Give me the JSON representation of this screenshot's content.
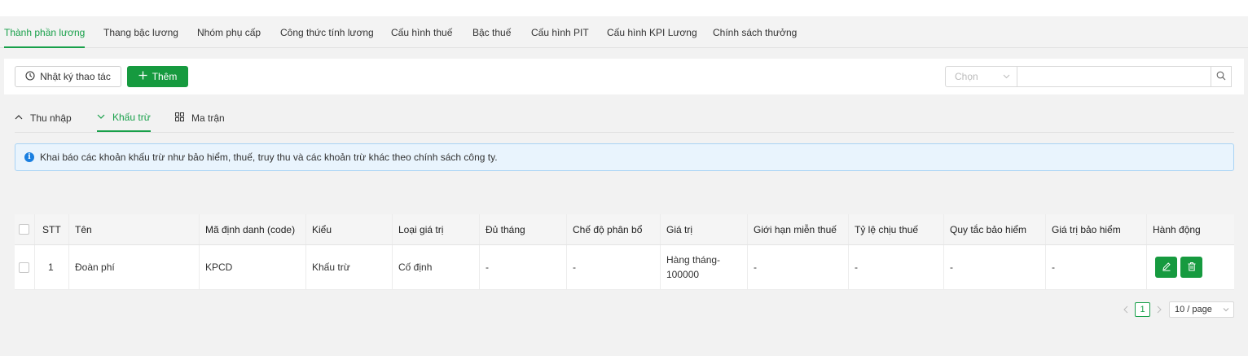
{
  "main_tabs": [
    {
      "label": "Thành phần lương"
    },
    {
      "label": "Thang bậc lương"
    },
    {
      "label": "Nhóm phụ cấp"
    },
    {
      "label": "Công thức tính lương"
    },
    {
      "label": "Cấu hình thuế"
    },
    {
      "label": "Bậc thuế"
    },
    {
      "label": "Cấu hình PIT"
    },
    {
      "label": "Cấu hình KPI Lương"
    },
    {
      "label": "Chính sách thưởng"
    }
  ],
  "toolbar": {
    "log_label": "Nhật ký thao tác",
    "add_label": "Thêm",
    "select_placeholder": "Chọn",
    "search_value": ""
  },
  "sub_tabs": [
    {
      "label": "Thu nhập",
      "icon": "chevron-up-icon"
    },
    {
      "label": "Khấu trừ",
      "icon": "chevron-down-icon"
    },
    {
      "label": "Ma trận",
      "icon": "grid-icon"
    }
  ],
  "alert": {
    "text": "Khai báo các khoản khấu trừ như bảo hiểm, thuế, truy thu và các khoản trừ khác theo chính sách công ty."
  },
  "table": {
    "columns": [
      "STT",
      "Tên",
      "Mã định danh (code)",
      "Kiểu",
      "Loại giá trị",
      "Đủ tháng",
      "Chế độ phân bổ",
      "Giá trị",
      "Giới hạn miễn thuế",
      "Tỷ lệ chịu thuế",
      "Quy tắc bảo hiểm",
      "Giá trị bảo hiểm",
      "Hành động"
    ],
    "rows": [
      {
        "stt": "1",
        "ten": "Đoàn phí",
        "code": "KPCD",
        "kieu": "Khấu trừ",
        "loai": "Cố định",
        "du_thang": "-",
        "che_do": "-",
        "gia_tri_1": "Hàng tháng-",
        "gia_tri_2": "100000",
        "gioi_han": "-",
        "ty_le": "-",
        "quy_tac": "-",
        "gia_tri_bh": "-"
      }
    ]
  },
  "pagination": {
    "current": "1",
    "page_size": "10 / page"
  },
  "colors": {
    "accent": "#18a04a",
    "button": "#169a3f",
    "info": "#1a7fe0"
  }
}
